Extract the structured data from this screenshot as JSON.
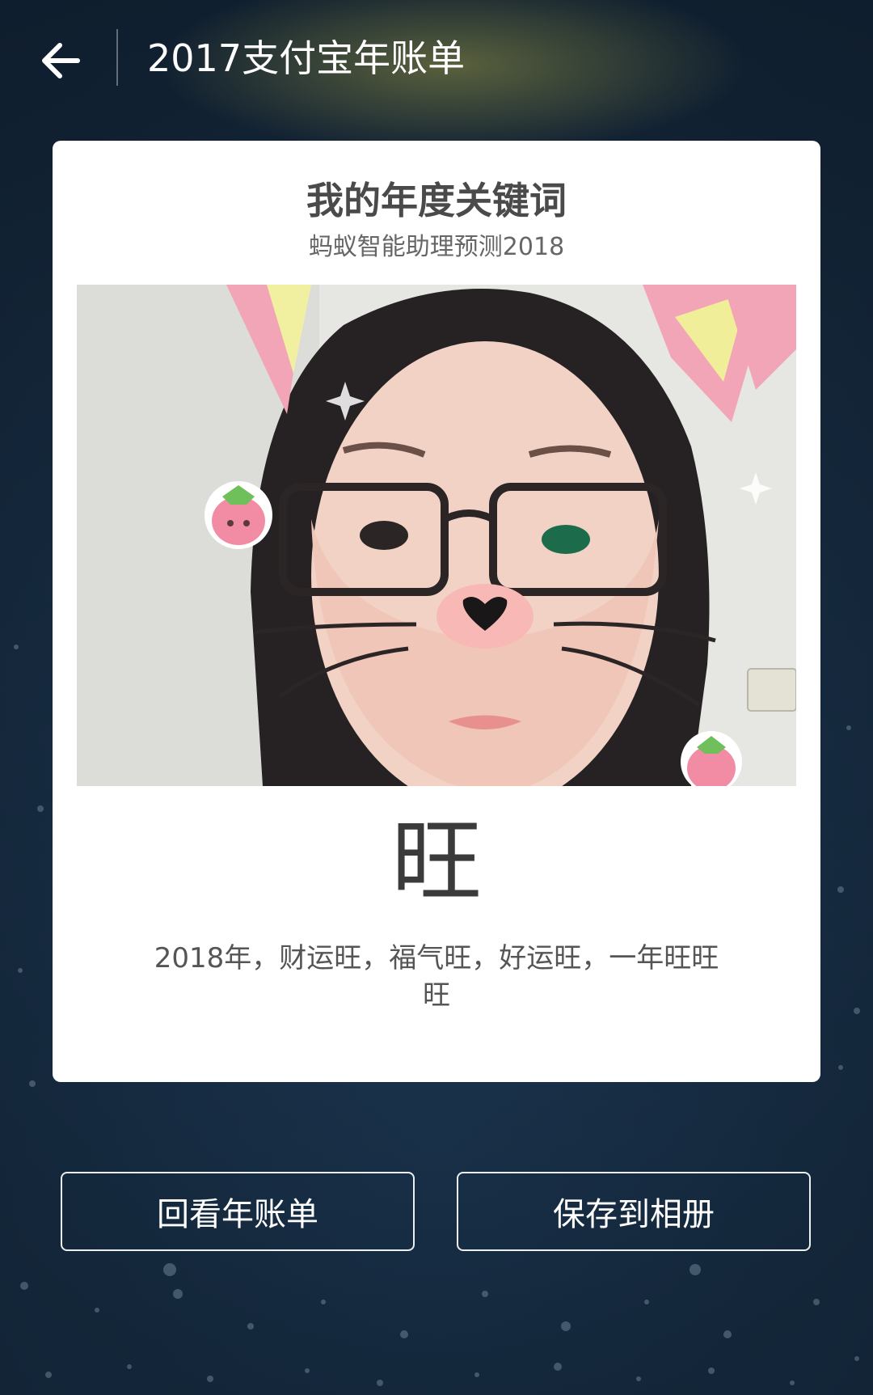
{
  "header": {
    "title": "2017支付宝年账单",
    "back_icon": "arrow-left-icon"
  },
  "card": {
    "title": "我的年度关键词",
    "subtitle": "蚂蚁智能助理预测2018",
    "keyword": "旺",
    "description_line1": "2018年，财运旺，福气旺，好运旺，一年旺旺",
    "description_line2": "旺"
  },
  "buttons": {
    "review_label": "回看年账单",
    "save_label": "保存到相册"
  },
  "colors": {
    "background": "#1e3247",
    "card": "#ffffff",
    "title_text": "#4a4a4a",
    "button_border": "#ffffff"
  }
}
